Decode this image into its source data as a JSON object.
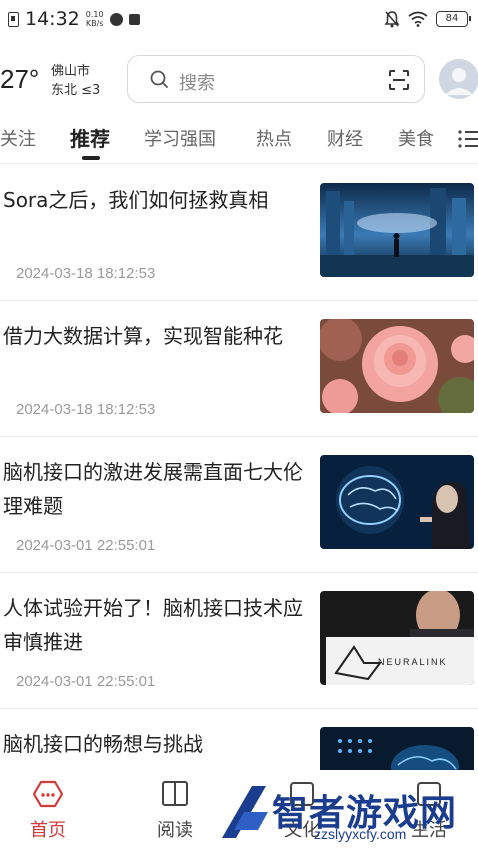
{
  "status_bar": {
    "time": "14:32",
    "net_speed_value": "0.10",
    "net_speed_unit": "KB/s",
    "battery": "84"
  },
  "header": {
    "temperature": "27°",
    "city": "佛山市",
    "wind": "东北 ≤3",
    "search_placeholder": "搜索"
  },
  "tabs": [
    {
      "label": "关注"
    },
    {
      "label": "推荐",
      "active": true
    },
    {
      "label": "学习强国"
    },
    {
      "label": "热点"
    },
    {
      "label": "财经"
    },
    {
      "label": "美食"
    }
  ],
  "articles": [
    {
      "title": "Sora之后，我们如何拯救真相",
      "date": "2024-03-18 18:12:53",
      "thumb": "futuristic-city-person"
    },
    {
      "title": "借力大数据计算，实现智能种花",
      "date": "2024-03-18 18:12:53",
      "thumb": "pink-roses"
    },
    {
      "title": "脑机接口的激进发展需直面七大伦理难题",
      "date": "2024-03-01 22:55:01",
      "thumb": "glowing-brain-woman"
    },
    {
      "title": "人体试验开始了！脑机接口技术应审慎推进",
      "date": "2024-03-01 22:55:01",
      "thumb": "neuralink-logo",
      "thumb_text": "NEURALINK"
    },
    {
      "title": "脑机接口的畅想与挑战",
      "date": "",
      "thumb": "blue-brain-circuit"
    }
  ],
  "bottom_nav": [
    {
      "label": "首页",
      "icon": "home-hexagon-icon",
      "active": true
    },
    {
      "label": "阅读",
      "icon": "book-icon"
    },
    {
      "label": "文化",
      "icon": "culture-icon"
    },
    {
      "label": "生活",
      "icon": "life-icon"
    }
  ],
  "watermark": {
    "text": "智者游戏网",
    "url": "zzslyyxcfy.com"
  },
  "colors": {
    "accent_red": "#d33a3a",
    "watermark_blue": "#1b3d8f",
    "date_gray": "#9a9a9a"
  }
}
